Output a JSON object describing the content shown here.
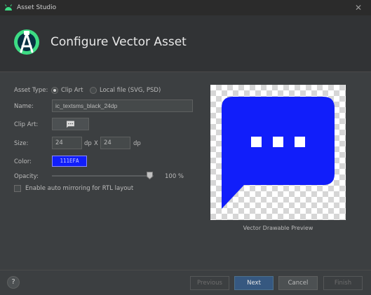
{
  "window": {
    "title": "Asset Studio",
    "close_icon": "close-icon"
  },
  "header": {
    "title": "Configure Vector Asset",
    "logo_icon": "android-studio-logo"
  },
  "form": {
    "asset_type_label": "Asset Type:",
    "asset_type_option_clip_art": "Clip Art",
    "asset_type_option_local_file": "Local file (SVG, PSD)",
    "asset_type_selected": "Clip Art",
    "name_label": "Name:",
    "name_value": "ic_textsms_black_24dp",
    "clip_art_label": "Clip Art:",
    "clip_art_icon": "textsms-icon",
    "size_label": "Size:",
    "size_width": "24",
    "size_width_unit": "dp",
    "size_separator": "X",
    "size_height": "24",
    "size_height_unit": "dp",
    "color_label": "Color:",
    "color_value": "111EFA",
    "color_hex": "#111efa",
    "opacity_label": "Opacity:",
    "opacity_value": "100 %",
    "opacity_fraction": 1.0,
    "auto_mirror_label": "Enable auto mirroring for RTL layout",
    "auto_mirror_checked": false
  },
  "preview": {
    "caption": "Vector Drawable Preview",
    "icon": "textsms-icon"
  },
  "footer": {
    "help_label": "?",
    "previous_label": "Previous",
    "next_label": "Next",
    "cancel_label": "Cancel",
    "finish_label": "Finish"
  }
}
